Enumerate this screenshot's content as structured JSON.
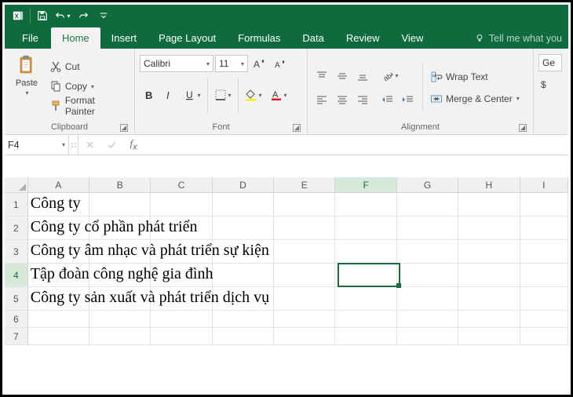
{
  "qat": {
    "icons": [
      "excel",
      "save",
      "undo",
      "redo",
      "more"
    ]
  },
  "tabs": {
    "file": "File",
    "home": "Home",
    "insert": "Insert",
    "pagelayout": "Page Layout",
    "formulas": "Formulas",
    "data": "Data",
    "review": "Review",
    "view": "View",
    "tellme": "Tell me what you"
  },
  "clipboard": {
    "paste": "Paste",
    "cut": "Cut",
    "copy": "Copy",
    "fmtpaint": "Format Painter",
    "group": "Clipboard"
  },
  "font": {
    "name": "Calibri",
    "size": "11",
    "group": "Font"
  },
  "alignment": {
    "wrap": "Wrap Text",
    "merge": "Merge & Center",
    "group": "Alignment"
  },
  "number": {
    "general": "Ge",
    "currency": "$"
  },
  "fbar": {
    "ref": "F4"
  },
  "columns": [
    "A",
    "B",
    "C",
    "D",
    "E",
    "F",
    "G",
    "H",
    "I"
  ],
  "rows": [
    "1",
    "2",
    "3",
    "4",
    "5",
    "6",
    "7"
  ],
  "selected": {
    "col": "F",
    "row": "4"
  },
  "cells": {
    "A1": "Công ty",
    "A2": "Công ty cổ phần phát triển",
    "A3": "Công ty âm nhạc và phát triển sự kiện",
    "A4": "Tập đoàn công nghệ gia đình",
    "A5": "Công ty sản xuất và phát triển dịch vụ"
  },
  "chart_data": null
}
